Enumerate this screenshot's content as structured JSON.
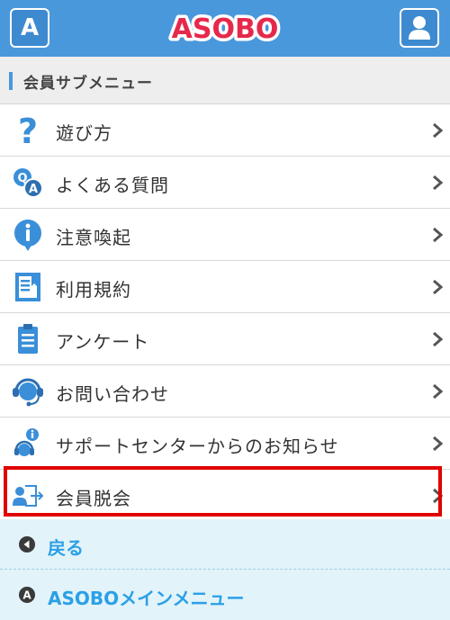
{
  "header": {
    "left_button_letter": "A",
    "logo_text": "ASOBO"
  },
  "section": {
    "title": "会員サブメニュー"
  },
  "menu": {
    "items": [
      {
        "label": "遊び方",
        "icon": "question-icon"
      },
      {
        "label": "よくある質問",
        "icon": "qa-icon"
      },
      {
        "label": "注意喚起",
        "icon": "info-icon"
      },
      {
        "label": "利用規約",
        "icon": "terms-book-icon"
      },
      {
        "label": "アンケート",
        "icon": "clipboard-icon"
      },
      {
        "label": "お問い合わせ",
        "icon": "headset-icon"
      },
      {
        "label": "サポートセンターからのお知らせ",
        "icon": "support-notice-icon"
      },
      {
        "label": "会員脱会",
        "icon": "withdraw-icon"
      }
    ]
  },
  "bottom_nav": {
    "back_label": "戻る",
    "main_menu_label": "ASOBOメインメニュー",
    "main_menu_icon_letter": "A"
  },
  "colors": {
    "header_blue": "#4a98dc",
    "highlight_red": "#e00000",
    "link_blue": "#2aa0e6",
    "nav_bg": "#e2f3fa"
  }
}
